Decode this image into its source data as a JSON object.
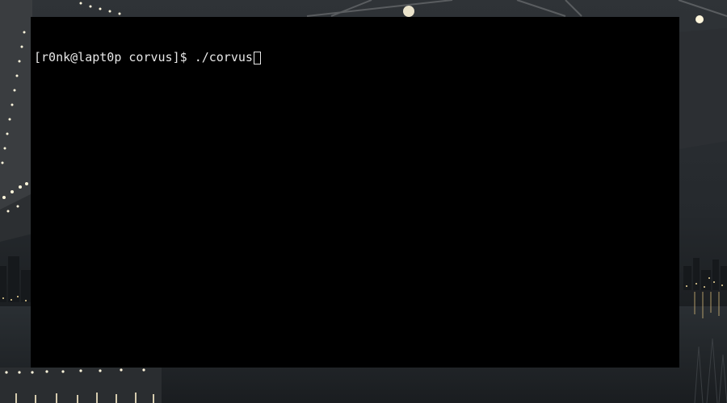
{
  "terminal": {
    "prompt": "[r0nk@lapt0p corvus]$ ",
    "command": "./corvus"
  },
  "colors": {
    "terminal_background": "#000000",
    "terminal_foreground": "#e8e8e8",
    "wallpaper_sky": "#2b2f33",
    "wallpaper_water": "#22262a",
    "bridge_lights": "#fff6dc"
  },
  "icons": {
    "cursor": "block-cursor-outline"
  }
}
